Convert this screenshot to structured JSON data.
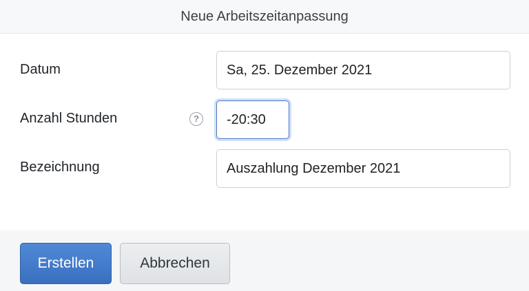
{
  "dialog": {
    "title": "Neue Arbeitszeitanpassung"
  },
  "form": {
    "datum": {
      "label": "Datum",
      "value": "Sa, 25. Dezember 2021"
    },
    "stunden": {
      "label": "Anzahl Stunden",
      "help_icon": "question-circle-icon",
      "help_glyph": "?",
      "value": "-20:30"
    },
    "bezeichnung": {
      "label": "Bezeichnung",
      "value": "Auszahlung Dezember 2021"
    }
  },
  "actions": {
    "create_label": "Erstellen",
    "cancel_label": "Abbrechen"
  },
  "colors": {
    "primary": "#3f78c8",
    "focus": "#4a78c2"
  }
}
